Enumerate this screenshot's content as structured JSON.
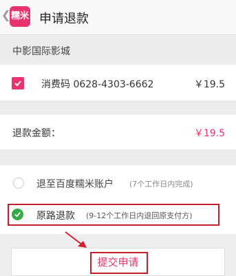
{
  "header": {
    "back_glyph": "❮",
    "logo_text": "糯米",
    "title": "申请退款"
  },
  "order": {
    "cinema": "中影国际影城",
    "code_label": "消费码 0628-4303-6662",
    "code_price": "￥19.5",
    "code_checked": true
  },
  "refund": {
    "label": "退款金额：",
    "amount": "￥19.5"
  },
  "options": [
    {
      "label": "退至百度糯米账户",
      "note": "(7个工作日内完成)",
      "selected": false
    },
    {
      "label": "原路退款",
      "note": "(9-12个工作日内退回原支付方)",
      "selected": true
    }
  ],
  "submit_label": "提交申请",
  "colors": {
    "accent": "#e8336d",
    "highlight_border": "#c41f2b",
    "check_green": "#33aa44"
  }
}
